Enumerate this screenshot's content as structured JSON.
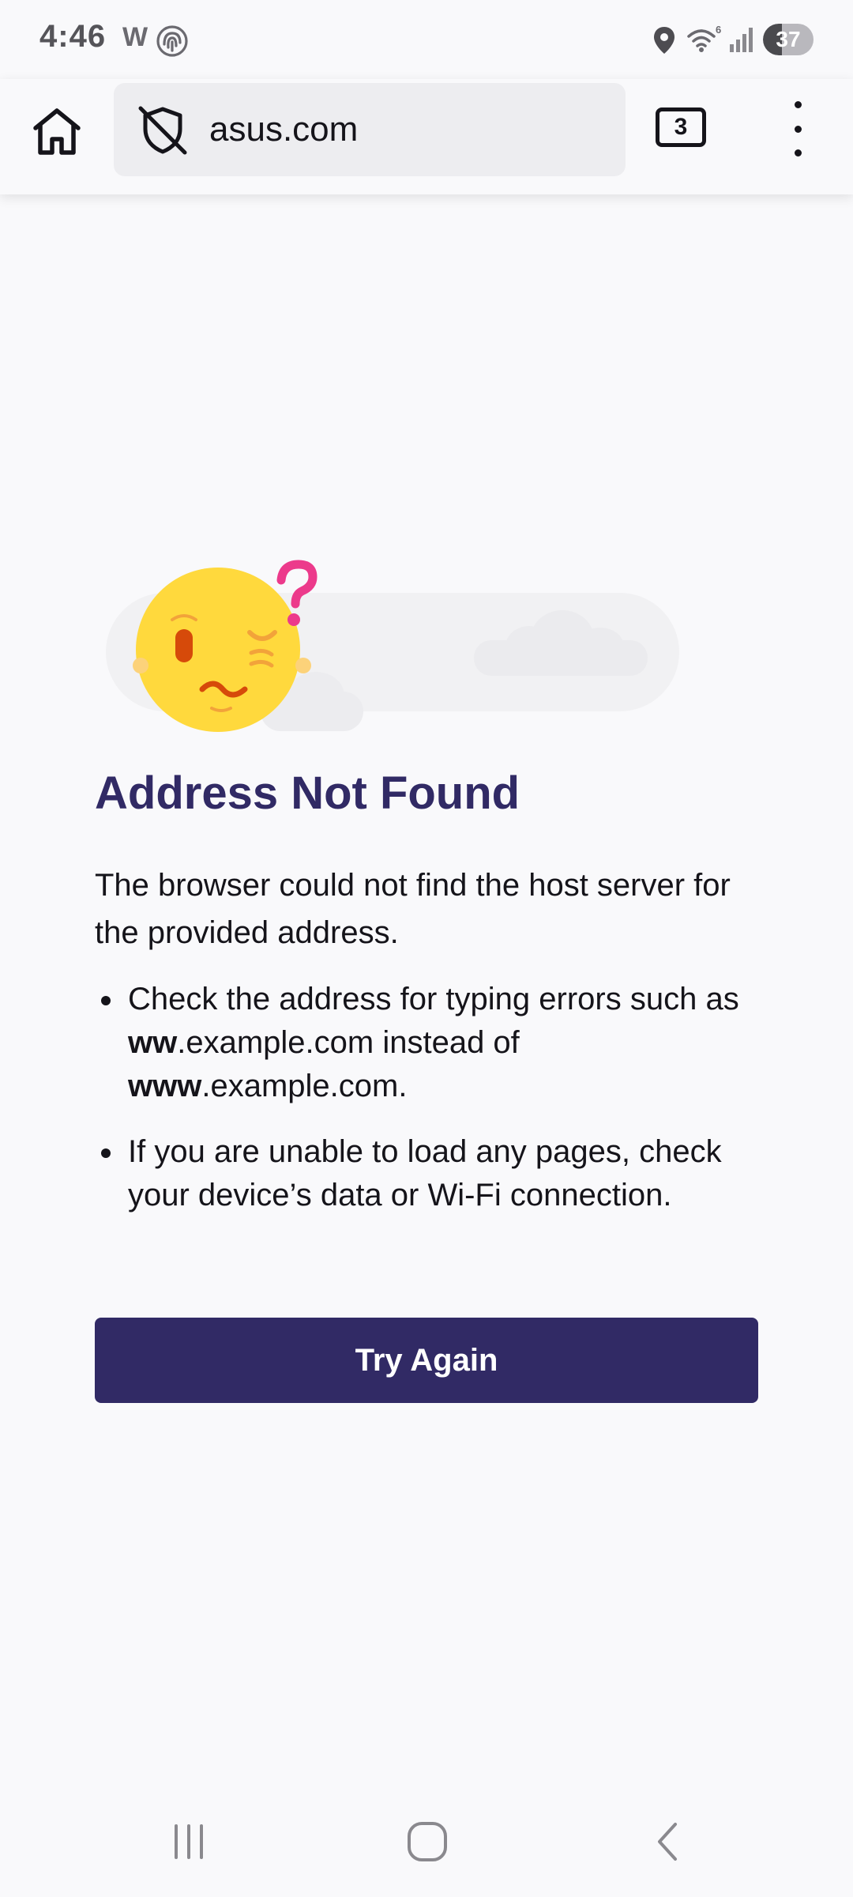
{
  "status_bar": {
    "time": "4:46",
    "app_indicator": "W",
    "battery_level": "37",
    "battery_fraction": 0.37,
    "icons": [
      "fingerprint-icon",
      "location-icon",
      "wifi-icon",
      "signal-icon",
      "battery-icon"
    ]
  },
  "toolbar": {
    "url": "asus.com",
    "tab_count": "3",
    "icons": [
      "home-icon",
      "tracking-protection-off-icon",
      "tabs-icon",
      "overflow-menu-icon"
    ]
  },
  "error_page": {
    "title": "Address Not Found",
    "description": "The browser could not find the host server for the provided address.",
    "tips": [
      {
        "text_before": "Check the address for typing errors such as ",
        "bold_1": "ww",
        "text_middle": ".example.com instead of ",
        "bold_2": "www",
        "text_after": ".example.com."
      },
      {
        "text": "If you are unable to load any pages, check your device’s data or Wi-Fi connection."
      }
    ],
    "button_label": "Try Again",
    "illustration": "confused-face-with-question-mark"
  },
  "nav_bar": {
    "icons": [
      "recent-apps-icon",
      "home-nav-icon",
      "back-icon"
    ]
  },
  "colors": {
    "accent": "#312a65",
    "background": "#f9f9fb",
    "url_bar": "#ededf0",
    "question_mark": "#ec3a8b",
    "face": "#ffd93d"
  }
}
